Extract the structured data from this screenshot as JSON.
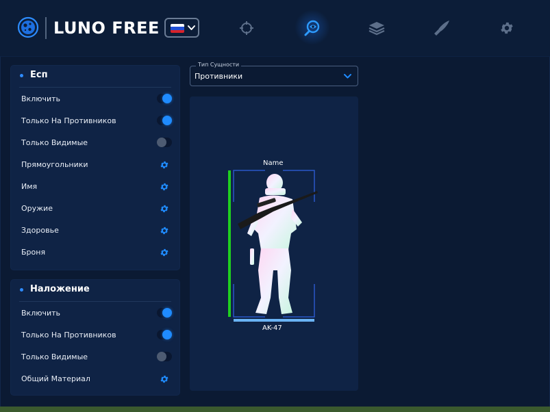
{
  "app": {
    "title": "LUNO FREE",
    "language": "ru"
  },
  "nav": {
    "items": [
      {
        "icon": "crosshair-icon",
        "active": false
      },
      {
        "icon": "eye-search-icon",
        "active": true
      },
      {
        "icon": "layers-icon",
        "active": false
      },
      {
        "icon": "knife-icon",
        "active": false
      },
      {
        "icon": "gear-icon",
        "active": false
      }
    ]
  },
  "esp_panel": {
    "title": "Есп",
    "rows": [
      {
        "label": "Включить",
        "control": "toggle",
        "on": true
      },
      {
        "label": "Только На Противников",
        "control": "toggle",
        "on": true
      },
      {
        "label": "Только Видимые",
        "control": "toggle",
        "on": false
      },
      {
        "label": "Прямоугольники",
        "control": "gear"
      },
      {
        "label": "Имя",
        "control": "gear"
      },
      {
        "label": "Оружие",
        "control": "gear"
      },
      {
        "label": "Здоровье",
        "control": "gear"
      },
      {
        "label": "Броня",
        "control": "gear"
      }
    ]
  },
  "overlay_panel": {
    "title": "Наложение",
    "rows": [
      {
        "label": "Включить",
        "control": "toggle",
        "on": true
      },
      {
        "label": "Только На Противников",
        "control": "toggle",
        "on": true
      },
      {
        "label": "Только Видимые",
        "control": "toggle",
        "on": false
      },
      {
        "label": "Общий Материал",
        "control": "gear"
      }
    ]
  },
  "entity_select": {
    "legend": "Тип Сущности",
    "value": "Противники"
  },
  "preview": {
    "name_label": "Name",
    "weapon_label": "AK-47",
    "health_fraction": 1.0,
    "armor_fraction": 1.0
  },
  "colors": {
    "accent": "#1f8bff",
    "health": "#1fcf1f",
    "armor": "#6ab4f5",
    "box": "#2a58c8"
  }
}
